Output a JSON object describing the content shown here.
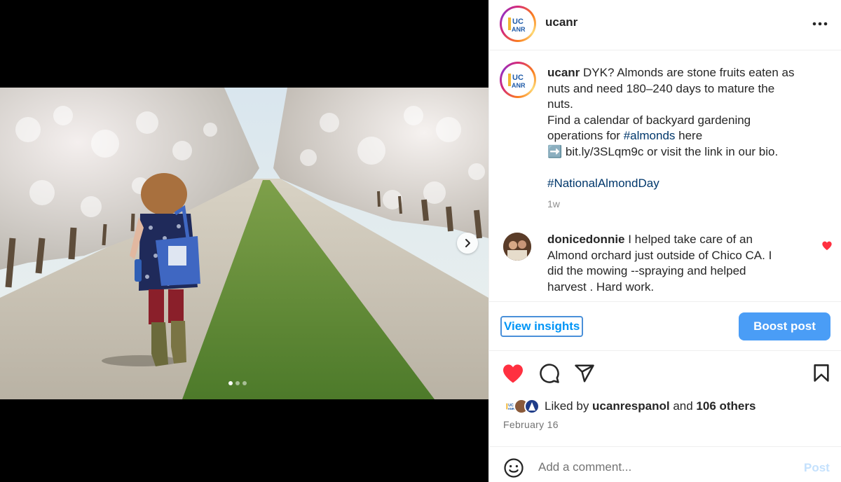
{
  "post": {
    "username": "ucanr",
    "avatar_text_top": "UC",
    "avatar_text_bottom": "ANR",
    "caption_username": "ucanr",
    "caption_lines": [
      " DYK? Almonds are stone fruits eaten as",
      "nuts and need 180–240 days to mature the",
      "nuts.",
      "Find a calendar of backyard gardening",
      "operations for "
    ],
    "caption_hashtag_1": "#almonds",
    "caption_after_hashtag": " here",
    "caption_link_line": "➡️ bit.ly/3SLqm9c or visit the link in our bio.",
    "caption_hashtag_2": "#NationalAlmondDay",
    "time_ago": "1w"
  },
  "comment": {
    "username": "donicedonnie",
    "text_lines": [
      " I helped take care of an",
      "Almond orchard just outside of Chico CA. I",
      "did the mowing --spraying and helped",
      "harvest . Hard work."
    ],
    "liked": true
  },
  "buttons": {
    "view_insights": "View insights",
    "boost_post": "Boost post",
    "post": "Post"
  },
  "likes": {
    "prefix": "Liked by ",
    "first_liker": "ucanrespanol",
    "middle": " and ",
    "others": "106 others"
  },
  "date": "February 16",
  "comment_input": {
    "placeholder": "Add a comment..."
  },
  "carousel": {
    "total_slides": 3,
    "active_slide": 1
  },
  "icons": {
    "more": "more-horizontal-icon",
    "like": "heart-icon",
    "comment": "comment-icon",
    "share": "share-icon",
    "save": "bookmark-icon",
    "emoji": "emoji-icon",
    "next": "chevron-right-icon"
  },
  "colors": {
    "like_red": "#ff3040",
    "link_blue": "#0095f6",
    "hashtag_blue": "#00376b",
    "boost_bg": "#4a9df6",
    "ucanr_blue": "#1f5ba8",
    "ucanr_gold": "#f2b632"
  }
}
